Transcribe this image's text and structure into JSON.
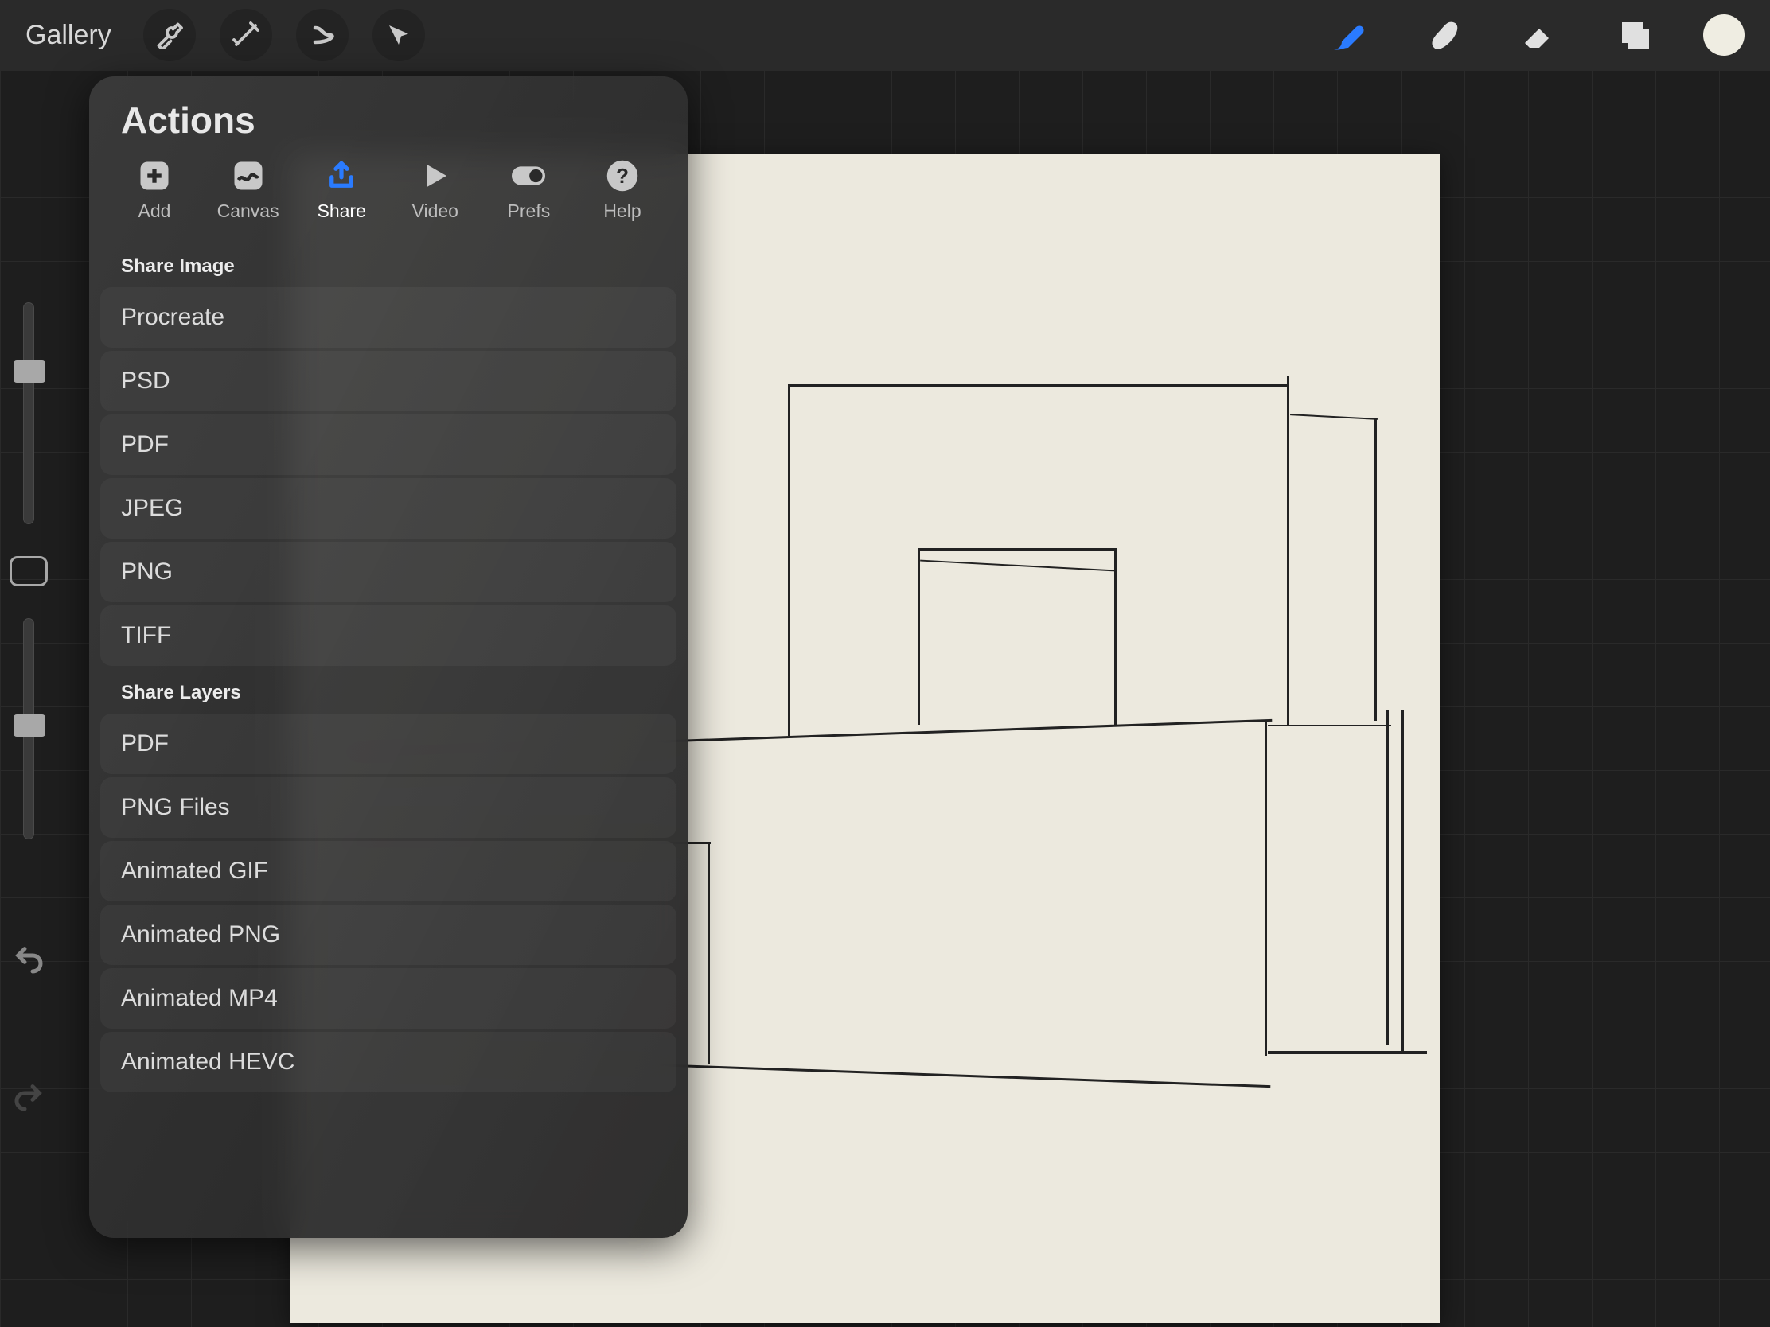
{
  "toolbar": {
    "gallery": "Gallery"
  },
  "panel": {
    "title": "Actions",
    "tabs": {
      "add": "Add",
      "canvas": "Canvas",
      "share": "Share",
      "video": "Video",
      "prefs": "Prefs",
      "help": "Help"
    },
    "section_image": "Share Image",
    "section_layers": "Share Layers",
    "image_formats": [
      "Procreate",
      "PSD",
      "PDF",
      "JPEG",
      "PNG",
      "TIFF"
    ],
    "layer_formats": [
      "PDF",
      "PNG Files",
      "Animated GIF",
      "Animated PNG",
      "Animated MP4",
      "Animated HEVC"
    ]
  },
  "colors": {
    "accent": "#2a7bff",
    "swatch": "#efede2"
  }
}
